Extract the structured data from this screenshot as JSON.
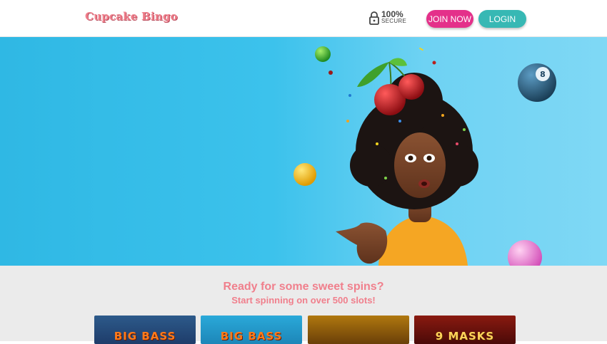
{
  "header": {
    "logo": "Cupcake Bingo",
    "secure_percent": "100%",
    "secure_label": "SECURE",
    "join_label": "JOIN NOW",
    "login_label": "LOGIN"
  },
  "promo": {
    "headline": "Ready for some sweet spins?",
    "subheadline": "Start spinning on over 500 slots!",
    "games": [
      {
        "title": "BIG BASS"
      },
      {
        "title": "BIG BASS"
      },
      {
        "title": ""
      },
      {
        "title": "9 MASKS"
      }
    ]
  },
  "colors": {
    "accent_pink": "#f07f8c",
    "join_button": "#e4308a",
    "login_button": "#37b8b4",
    "hero_background": "#3cc2ec"
  },
  "icons": [
    "lock-icon",
    "cherry-icon",
    "bingo-ball-icon"
  ]
}
